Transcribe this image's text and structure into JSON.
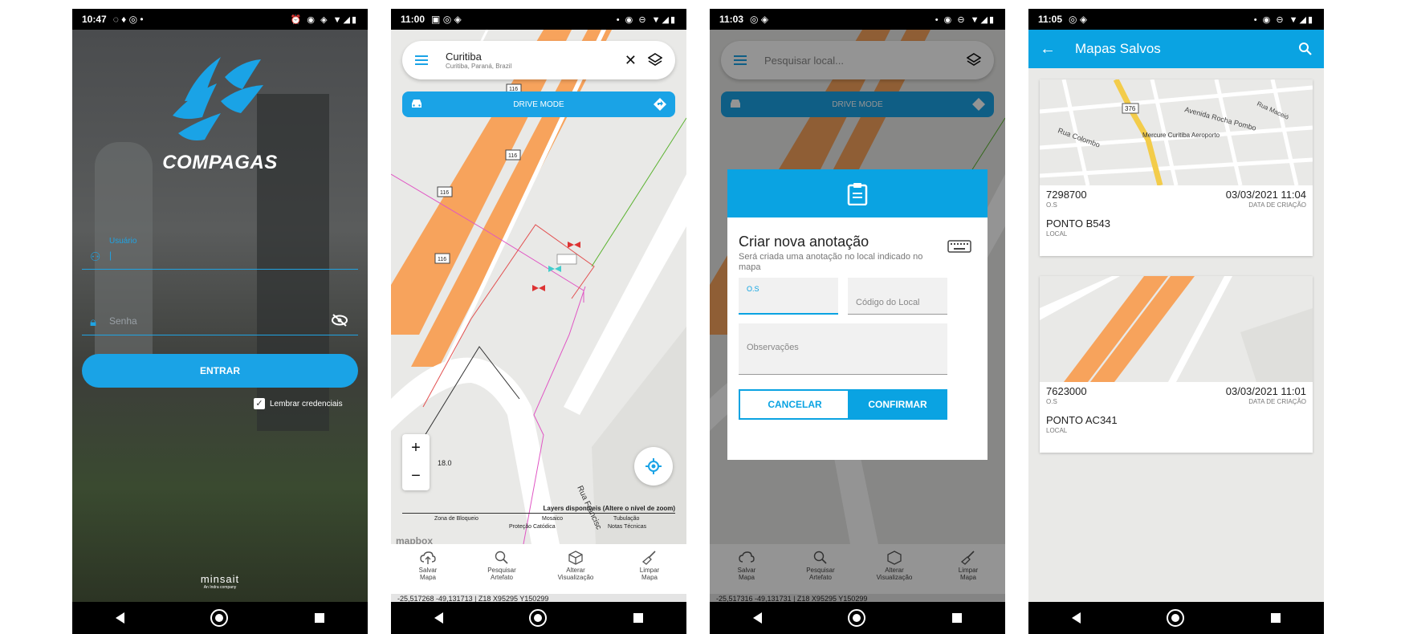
{
  "screens": [
    {
      "status_time": "10:47",
      "brand": "COMPAGAS",
      "username_label": "Usuário",
      "password_placeholder": "Senha",
      "login_button": "ENTRAR",
      "remember_label": "Lembrar credenciais",
      "footer_brand": "minsait",
      "footer_sub": "An Indra company"
    },
    {
      "status_time": "11:00",
      "search_title": "Curitiba",
      "search_subtitle": "Curitiba, Paraná, Brazil",
      "drive_mode": "DRIVE MODE",
      "zoom_in": "+",
      "zoom_out": "−",
      "scale_value": "18.0",
      "legend_title": "Layers disponíveis (Altere o nível de zoom)",
      "legend_items": [
        "Zona de Bloqueio",
        "Mosaico",
        "Tubulação",
        "Proteção Catódica",
        "Notas Técnicas"
      ],
      "road_labels": [
        "116",
        "116",
        "116",
        "116",
        "116"
      ],
      "street_label": "Rua Francisc",
      "mapbox": "mapbox",
      "tools": [
        {
          "line1": "Salvar",
          "line2": "Mapa"
        },
        {
          "line1": "Pesquisar",
          "line2": "Artefato"
        },
        {
          "line1": "Alterar",
          "line2": "Visualização"
        },
        {
          "line1": "Limpar",
          "line2": "Mapa"
        }
      ],
      "coords": "-25,517268 -49,131713 | Z18 X95295 Y150299"
    },
    {
      "status_time": "11:03",
      "search_placeholder": "Pesquisar local...",
      "drive_mode": "DRIVE MODE",
      "coords": "-25,517316 -49,131731 | Z18 X95295 Y150299",
      "dialog": {
        "title": "Criar nova anotação",
        "subtitle": "Será criada uma anotação no local indicado no mapa",
        "os_label": "O.S",
        "code_placeholder": "Código do Local",
        "notes_placeholder": "Observações",
        "cancel": "CANCELAR",
        "confirm": "CONFIRMAR"
      }
    },
    {
      "status_time": "11:05",
      "title": "Mapas Salvos",
      "cards": [
        {
          "os": "7298700",
          "os_label": "O.S",
          "date": "03/03/2021 11:04",
          "date_label": "DATA DE CRIAÇÃO",
          "local": "PONTO B543",
          "local_label": "LOCAL",
          "map_labels": [
            "Avenida Rocha Pombo",
            "Rua Maceió",
            "Rua Colombo",
            "Mercure Curitiba Aeroporto",
            "376"
          ]
        },
        {
          "os": "7623000",
          "os_label": "O.S",
          "date": "03/03/2021 11:01",
          "date_label": "DATA DE CRIAÇÃO",
          "local": "PONTO AC341",
          "local_label": "LOCAL",
          "map_labels": []
        }
      ]
    }
  ],
  "colors": {
    "accent": "#1aa3e6",
    "pipe": "#f7a35c",
    "zone": "#e8567a"
  }
}
